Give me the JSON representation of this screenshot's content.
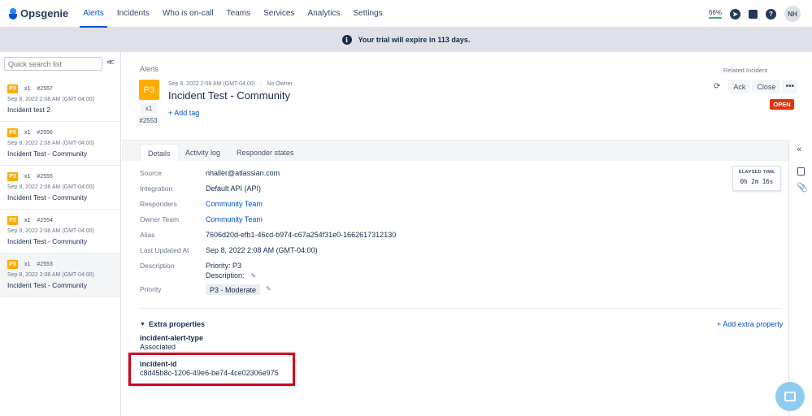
{
  "nav": {
    "logo": "Opsgenie",
    "items": [
      "Alerts",
      "Incidents",
      "Who is on-call",
      "Teams",
      "Services",
      "Analytics",
      "Settings"
    ],
    "progress_pct": "66%",
    "avatar_initials": "NH"
  },
  "banner": {
    "text": "Your trial will expire in 113 days."
  },
  "sidebar": {
    "search_placeholder": "Quick search list",
    "items": [
      {
        "priority": "P3",
        "count": "x1",
        "number": "#2557",
        "date": "Sep 8, 2022 2:08 AM (GMT-04:00)",
        "title": "Incident test 2"
      },
      {
        "priority": "P3",
        "count": "x1",
        "number": "#2556",
        "date": "Sep 8, 2022 2:08 AM (GMT-04:00)",
        "title": "Incident Test - Community"
      },
      {
        "priority": "P3",
        "count": "x1",
        "number": "#2555",
        "date": "Sep 8, 2022 2:08 AM (GMT-04:00)",
        "title": "Incident Test - Community"
      },
      {
        "priority": "P3",
        "count": "x1",
        "number": "#2554",
        "date": "Sep 8, 2022 2:08 AM (GMT-04:00)",
        "title": "Incident Test - Community"
      },
      {
        "priority": "P3",
        "count": "x1",
        "number": "#2553",
        "date": "Sep 8, 2022 2:08 AM (GMT-04:00)",
        "title": "Incident Test - Community"
      }
    ]
  },
  "alert": {
    "breadcrumb": "Alerts",
    "priority": "P3",
    "count": "x1",
    "number": "#2553",
    "date": "Sep 8, 2022 2:08 AM (GMT-04:00)",
    "owner": "No Owner",
    "separator": "·",
    "title": "Incident Test - Community",
    "add_tag": "+ Add tag",
    "related": "Related Incident",
    "ack_label": "Ack",
    "close_label": "Close",
    "more_label": "•••",
    "status": "OPEN"
  },
  "tabs": [
    "Details",
    "Activity log",
    "Responder states"
  ],
  "details": {
    "source_label": "Source",
    "source": "nhaller@atlassian.com",
    "integration_label": "Integration",
    "integration": "Default API (API)",
    "responders_label": "Responders",
    "responders": "Community Team",
    "owner_team_label": "Owner Team",
    "owner_team": "Community Team",
    "alias_label": "Alias",
    "alias": "7606d20d-efb1-46cd-b974-c67a254f31e0-1662617312130",
    "updated_label": "Last Updated At",
    "updated": "Sep 8, 2022 2:08 AM (GMT-04:00)",
    "description_label": "Description",
    "description_line1": "Priority: P3",
    "description_line2": "Description:",
    "priority_label": "Priority",
    "priority": "P3 - Moderate"
  },
  "elapsed": {
    "label": "ELAPSED TIME",
    "value": "0h 2m 16s"
  },
  "extra": {
    "heading": "Extra properties",
    "add": "+ Add extra property",
    "props": [
      {
        "key": "incident-alert-type",
        "value": "Associated"
      },
      {
        "key": "incident-id",
        "value": "c8d45b8c-1206-49e6-be74-4ce02306e975"
      }
    ]
  },
  "colors": {
    "brand": "#0052cc",
    "priority_p3": "#ffab00",
    "open_status": "#de350b",
    "highlight_box": "#d0021b"
  },
  "icons": [
    "info-icon",
    "refresh-icon",
    "collapse-icon",
    "pencil-icon",
    "chevron-down-icon",
    "document-icon",
    "paperclip-icon",
    "chat-icon",
    "help-icon",
    "book-icon",
    "compass-icon"
  ]
}
